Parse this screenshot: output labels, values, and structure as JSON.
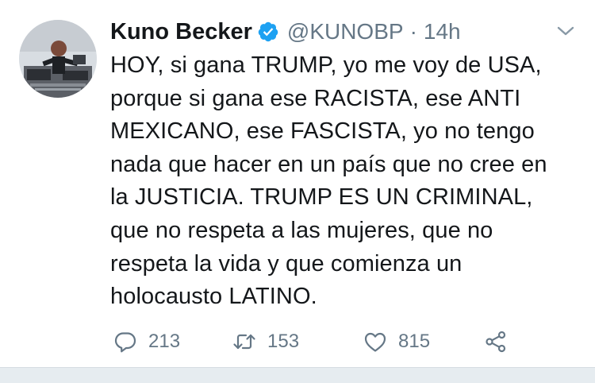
{
  "tweet": {
    "author_name": "Kuno Becker",
    "handle": "@KUNOBP",
    "separator": "·",
    "time": "14h",
    "verified": true,
    "text": "HOY, si gana TRUMP, yo me voy de USA,\nporque si gana ese RACISTA, ese ANTI\nMEXICANO, ese FASCISTA, yo no tengo\nnada que hacer en un país que no cree en\nla JUSTICIA. TRUMP ES UN CRIMINAL,\nque no respeta a las mujeres, que no\nrespeta la vida y que comienza un\nholocausto LATINO.",
    "actions": {
      "reply_count": "213",
      "retweet_count": "153",
      "like_count": "815"
    }
  },
  "icons": {
    "avatar": "avatar",
    "verified": "verified-badge-icon",
    "caret": "chevron-down-icon",
    "reply": "reply-icon",
    "retweet": "retweet-icon",
    "like": "heart-icon",
    "share": "share-icon"
  },
  "colors": {
    "verified_blue": "#1da1f2",
    "text": "#14171a",
    "muted": "#657786",
    "divider": "#e6ecf0"
  }
}
